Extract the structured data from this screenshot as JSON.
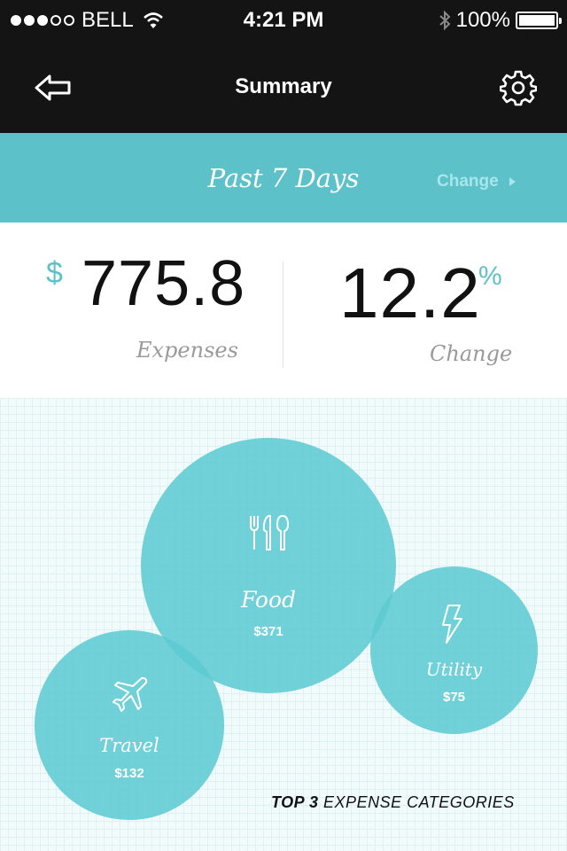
{
  "status_bar": {
    "carrier": "BELL",
    "time": "4:21 PM",
    "battery": "100%",
    "signal_icon": "signal-dots-icon",
    "wifi_icon": "wifi-icon",
    "bluetooth_icon": "bluetooth-icon",
    "battery_icon": "battery-icon"
  },
  "nav": {
    "title": "Summary",
    "back_icon": "back-arrow-icon",
    "settings_icon": "gear-icon"
  },
  "period": {
    "label": "Past 7 Days",
    "change_label": "Change"
  },
  "metrics": {
    "currency_symbol": "$",
    "expenses_value": "775.8",
    "expenses_label": "Expenses",
    "change_value": "12.2",
    "change_unit": "%",
    "change_label": "Change"
  },
  "categories": [
    {
      "name": "Food",
      "amount": "$371",
      "icon": "utensils-icon"
    },
    {
      "name": "Utility",
      "amount": "$75",
      "icon": "lightning-icon"
    },
    {
      "name": "Travel",
      "amount": "$132",
      "icon": "airplane-icon"
    }
  ],
  "caption": {
    "bold": "TOP 3",
    "rest": "EXPENSE CATEGORIES"
  },
  "colors": {
    "accent": "#5cc1c8",
    "bubble": "#5ccad2",
    "dark": "#141414"
  }
}
